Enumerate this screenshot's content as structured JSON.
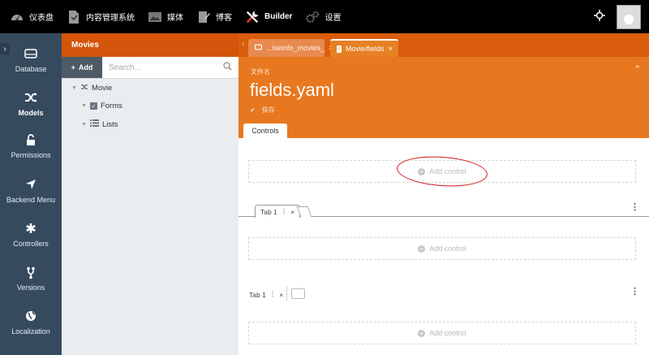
{
  "topbar": {
    "items": [
      {
        "label": "仪表盘",
        "icon": "dashboard-icon"
      },
      {
        "label": "内容管理系统",
        "icon": "cms-icon"
      },
      {
        "label": "媒体",
        "icon": "media-icon"
      },
      {
        "label": "博客",
        "icon": "blog-icon"
      },
      {
        "label": "Builder",
        "icon": "builder-icon",
        "active": true
      },
      {
        "label": "设置",
        "icon": "settings-icon"
      }
    ]
  },
  "leftnav": {
    "items": [
      {
        "label": "Database",
        "icon": "database-icon"
      },
      {
        "label": "Models",
        "icon": "shuffle-icon",
        "active": true
      },
      {
        "label": "Permissions",
        "icon": "unlock-icon"
      },
      {
        "label": "Backend Menu",
        "icon": "location-arrow-icon"
      },
      {
        "label": "Controllers",
        "icon": "asterisk-icon"
      },
      {
        "label": "Versions",
        "icon": "code-fork-icon"
      },
      {
        "label": "Localization",
        "icon": "globe-icon"
      }
    ]
  },
  "treepanel": {
    "title": "Movies",
    "add_label": "Add",
    "search_placeholder": "Search...",
    "nodes": [
      {
        "label": "Movie"
      },
      {
        "label": "Forms"
      },
      {
        "label": "Lists"
      }
    ]
  },
  "editor": {
    "tabs": [
      {
        "label": "...iseinfo_movies_"
      },
      {
        "label": "Movie/fields",
        "active": true
      }
    ],
    "filename_label": "文件名",
    "filename": "fields.yaml",
    "save_label": "保存",
    "section_tab": "Controls",
    "add_control_label": "Add control",
    "subtab_label": "Tab 1",
    "colors": {
      "accent": "#e8781f",
      "nav": "#364a5e"
    }
  }
}
